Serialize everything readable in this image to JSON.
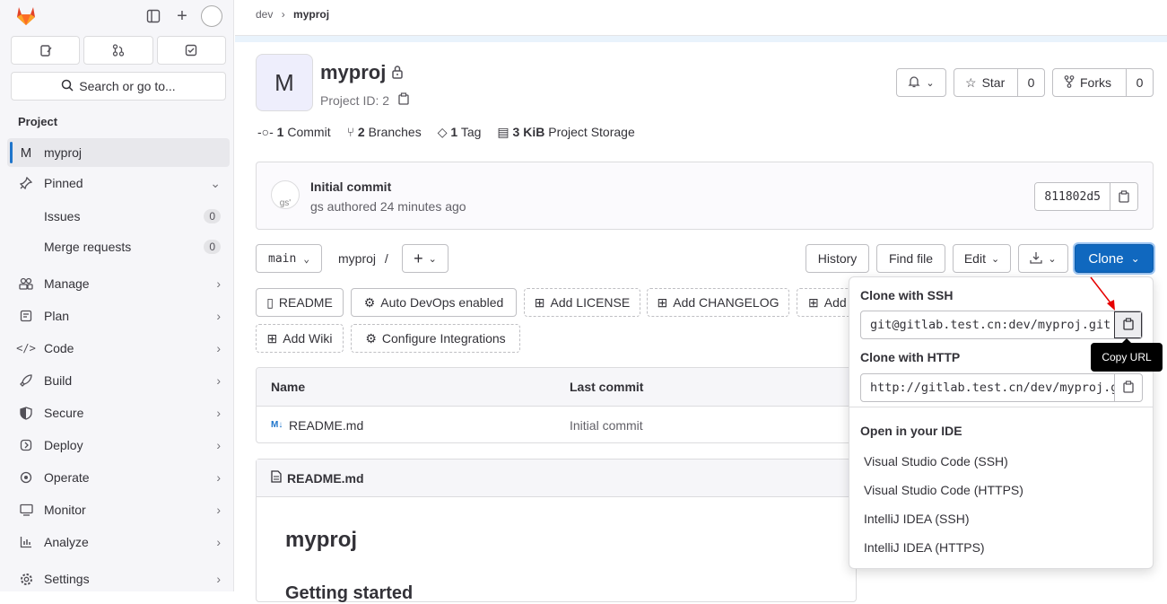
{
  "sidebar": {
    "section_title": "Project",
    "search_placeholder": "Search or go to...",
    "project_initial": "M",
    "project_name": "myproj",
    "pinned": "Pinned",
    "issues": "Issues",
    "issues_count": "0",
    "merge_requests": "Merge requests",
    "mr_count": "0",
    "items": [
      {
        "label": "Manage",
        "icon": "users-icon"
      },
      {
        "label": "Plan",
        "icon": "plan-icon"
      },
      {
        "label": "Code",
        "icon": "code-icon"
      },
      {
        "label": "Build",
        "icon": "rocket-icon"
      },
      {
        "label": "Secure",
        "icon": "shield-icon"
      },
      {
        "label": "Deploy",
        "icon": "deploy-icon"
      },
      {
        "label": "Operate",
        "icon": "cloud-gear-icon"
      },
      {
        "label": "Monitor",
        "icon": "monitor-icon"
      },
      {
        "label": "Analyze",
        "icon": "chart-icon"
      },
      {
        "label": "Settings",
        "icon": "gear-icon"
      }
    ]
  },
  "breadcrumb": {
    "group": "dev",
    "project": "myproj"
  },
  "project": {
    "initial": "M",
    "name": "myproj",
    "id_label": "Project ID: 2",
    "star": "Star",
    "star_count": "0",
    "forks": "Forks",
    "forks_count": "0"
  },
  "stats": {
    "commits_n": "1",
    "commits": "Commit",
    "branches_n": "2",
    "branches": "Branches",
    "tags_n": "1",
    "tags": "Tag",
    "storage_n": "3 KiB",
    "storage": "Project Storage"
  },
  "commit": {
    "title": "Initial commit",
    "author": "gs",
    "meta": " authored 24 minutes ago",
    "sha": "811802d5",
    "avatar_alt": "gs'"
  },
  "repo_bar": {
    "branch": "main",
    "path": "myproj",
    "sep": "/",
    "history": "History",
    "find_file": "Find file",
    "edit": "Edit",
    "clone": "Clone"
  },
  "shortcuts": [
    "README",
    "Auto DevOps enabled",
    "Add LICENSE",
    "Add CHANGELOG",
    "Add",
    "Add Wiki",
    "Configure Integrations"
  ],
  "files": {
    "col_name": "Name",
    "col_last_commit": "Last commit",
    "rows": [
      {
        "name": "README.md",
        "commit": "Initial commit"
      }
    ]
  },
  "readme": {
    "header": "README.md",
    "h1": "myproj",
    "h2": "Getting started"
  },
  "clone_dropdown": {
    "ssh_label": "Clone with SSH",
    "ssh_url": "git@gitlab.test.cn:dev/myproj.git",
    "http_label": "Clone with HTTP",
    "http_url": "http://gitlab.test.cn/dev/myproj.git",
    "ide_label": "Open in your IDE",
    "ide_items": [
      "Visual Studio Code (SSH)",
      "Visual Studio Code (HTTPS)",
      "IntelliJ IDEA (SSH)",
      "IntelliJ IDEA (HTTPS)"
    ]
  },
  "tooltip": "Copy URL",
  "colors": {
    "accent": "#1068bf",
    "arrow": "#e60000",
    "logo": "#e24329"
  }
}
